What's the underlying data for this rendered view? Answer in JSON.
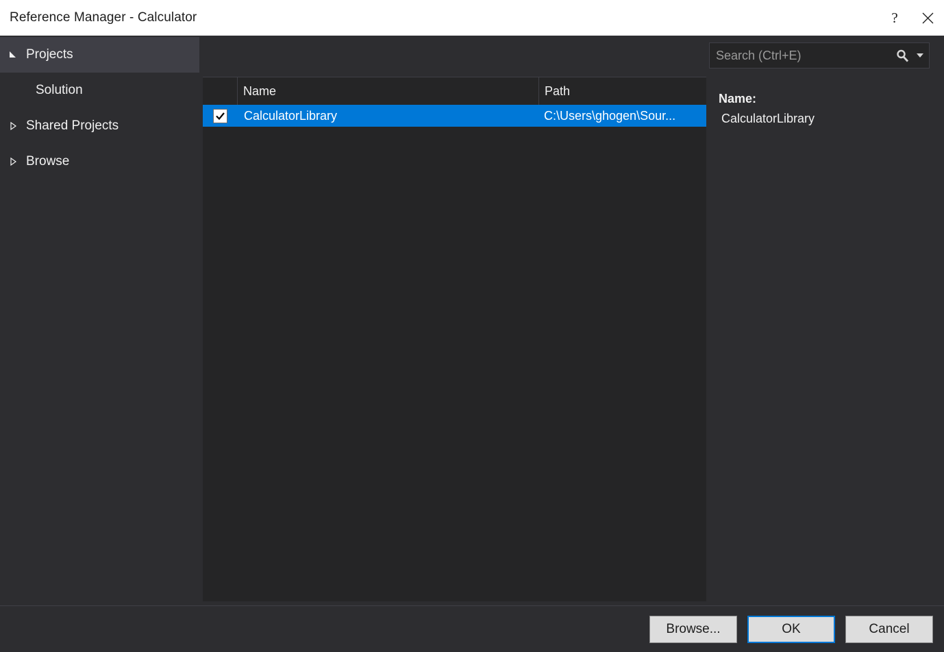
{
  "window": {
    "title": "Reference Manager - Calculator",
    "help_icon": "question-mark-icon",
    "close_icon": "close-icon"
  },
  "sidebar": {
    "items": [
      {
        "label": "Projects",
        "state": "expanded",
        "selected": true,
        "icon": "triangle-expanded-icon",
        "child": false
      },
      {
        "label": "Solution",
        "state": "leaf",
        "selected": false,
        "icon": "",
        "child": true
      },
      {
        "label": "Shared Projects",
        "state": "collapsed",
        "selected": false,
        "icon": "triangle-collapsed-icon",
        "child": false
      },
      {
        "label": "Browse",
        "state": "collapsed",
        "selected": false,
        "icon": "triangle-collapsed-icon",
        "child": false
      }
    ]
  },
  "search": {
    "placeholder": "Search (Ctrl+E)",
    "value": "",
    "icon": "search-icon",
    "dropdown_icon": "chevron-down-icon"
  },
  "list": {
    "columns": [
      "",
      "Name",
      "Path"
    ],
    "rows": [
      {
        "checked": true,
        "name": "CalculatorLibrary",
        "path": "C:\\Users\\ghogen\\Sour...",
        "selected": true
      }
    ]
  },
  "details": {
    "name_label": "Name:",
    "name_value": "CalculatorLibrary"
  },
  "footer": {
    "browse_label": "Browse...",
    "ok_label": "OK",
    "cancel_label": "Cancel"
  },
  "colors": {
    "accent": "#0078d7",
    "dialog_bg": "#2d2d30",
    "panel_bg": "#252526",
    "selected_nav_bg": "#3f3f46",
    "titlebar_bg": "#ffffff",
    "text": "#f1f1f1"
  }
}
